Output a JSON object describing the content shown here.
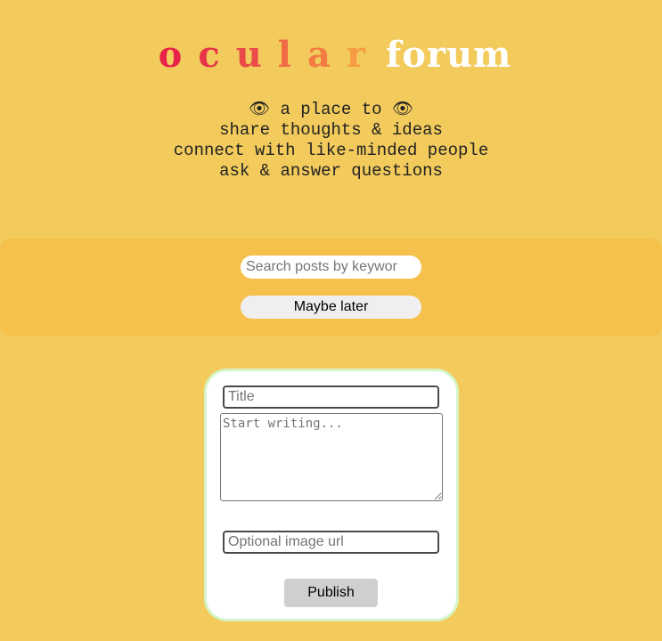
{
  "header": {
    "logo_letters": [
      {
        "char": "o",
        "color": "#e8234a"
      },
      {
        "char": "c",
        "color": "#e8344a"
      },
      {
        "char": "u",
        "color": "#ea4a48"
      },
      {
        "char": "l",
        "color": "#ef6a45"
      },
      {
        "char": "a",
        "color": "#f37c42"
      },
      {
        "char": "r",
        "color": "#f69a44"
      }
    ],
    "logo_word": "forum",
    "tagline": [
      "👁 a place to 👁",
      "share thoughts & ideas",
      "connect with like-minded people",
      "ask & answer questions"
    ]
  },
  "search": {
    "placeholder": "Search posts by keywor",
    "later_label": "Maybe later"
  },
  "post_form": {
    "title_placeholder": "Title",
    "body_placeholder": "Start writing...",
    "image_placeholder": "Optional image url",
    "publish_label": "Publish"
  },
  "colors": {
    "background": "#f2cb5c",
    "search_band": "#f5c14c",
    "card_border": "#d5f5c8"
  }
}
